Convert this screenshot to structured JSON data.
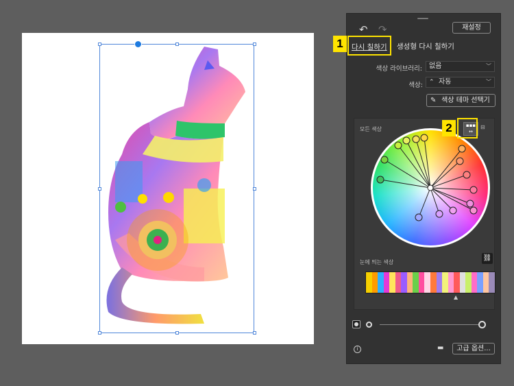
{
  "panel": {
    "undo_icon": "undo-icon",
    "redo_icon": "redo-icon",
    "reset_label": "재설정",
    "tabs": {
      "recolor": "다시 칠하기",
      "generative": "생성형 다시 칠하기"
    },
    "color_library_label": "색상 라이브러리:",
    "color_library_value": "없음",
    "colors_label": "색상:",
    "colors_value": "자동",
    "theme_picker_label": "색상 테마 선택기",
    "all_colors_label": "모든 색상",
    "prominent_colors_label": "눈에 띄는 색상",
    "advanced_label": "고급 옵션...",
    "callouts": [
      "1",
      "2"
    ]
  },
  "prominent_colors": [
    "#f7d000",
    "#ff9c00",
    "#2fb0ff",
    "#e43ad6",
    "#ffe45c",
    "#f05a8c",
    "#9b5cff",
    "#ffb27a",
    "#6ad04a",
    "#ff4fa0",
    "#ffd6e6",
    "#ff7a3c",
    "#a07cf0",
    "#f2f27a",
    "#ff98d0",
    "#ff5a5a",
    "#e0e0e0",
    "#c9f06a",
    "#ff6cc8",
    "#7aa0ff",
    "#ffc6a0",
    "#9a8ab8"
  ]
}
